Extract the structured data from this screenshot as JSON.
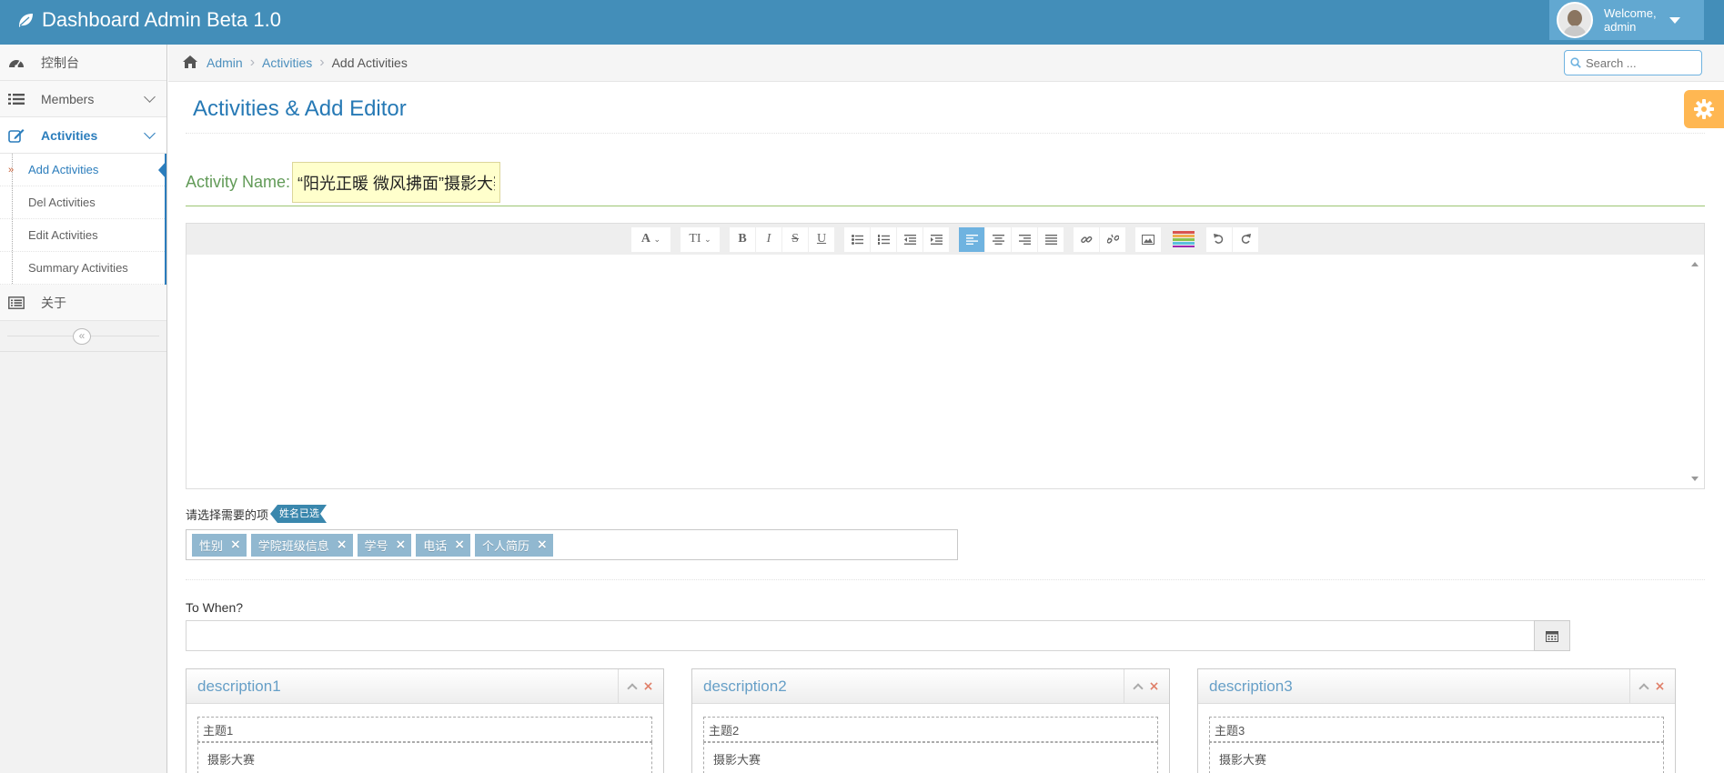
{
  "navbar": {
    "brand": "Dashboard Admin Beta 1.0",
    "welcome_line1": "Welcome,",
    "welcome_line2": "admin"
  },
  "sidebar": {
    "items": [
      {
        "label": "控制台",
        "icon": "tachometer-icon"
      },
      {
        "label": "Members",
        "icon": "list-icon"
      },
      {
        "label": "Activities",
        "icon": "pencil-square-icon"
      },
      {
        "label": "关于",
        "icon": "list-alt-icon"
      }
    ],
    "sub_items": [
      {
        "label": "Add Activities"
      },
      {
        "label": "Del Activities"
      },
      {
        "label": "Edit Activities"
      },
      {
        "label": "Summary Activities"
      }
    ]
  },
  "breadcrumb": {
    "items": [
      "Admin",
      "Activities",
      "Add Activities"
    ]
  },
  "search": {
    "placeholder": "Search ..."
  },
  "page": {
    "title": "Activities & Add Editor"
  },
  "activity": {
    "label": "Activity Name:",
    "value": "“阳光正暖 微风拂面”摄影大赛"
  },
  "colors": {
    "navbar": "#438eb9",
    "accent": "#2b7dbc",
    "settings": "#ffb752",
    "tag": "#91b8d0",
    "label_green": "#629b58"
  },
  "fields": {
    "label": "请选择需要的项",
    "ribbon": "姓名已选",
    "tags": [
      "性别",
      "学院班级信息",
      "学号",
      "电话",
      "个人简历"
    ]
  },
  "when": {
    "label": "To When?",
    "value": ""
  },
  "widgets": [
    {
      "title": "description1",
      "field1": "主题1",
      "field2": "摄影大赛"
    },
    {
      "title": "description2",
      "field1": "主题2",
      "field2": "摄影大赛"
    },
    {
      "title": "description3",
      "field1": "主题3",
      "field2": "摄影大赛"
    }
  ]
}
